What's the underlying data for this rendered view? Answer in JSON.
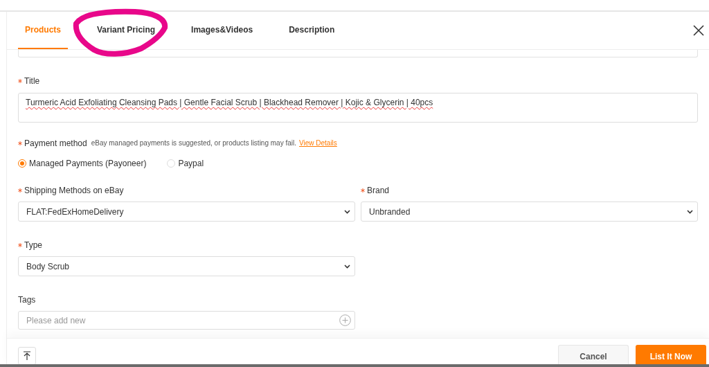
{
  "tabs": [
    {
      "label": "Products",
      "selected": true
    },
    {
      "label": "Variant Pricing",
      "selected": false
    },
    {
      "label": "Images&Videos",
      "selected": false
    },
    {
      "label": "Description",
      "selected": false
    }
  ],
  "title_field": {
    "label": "Title",
    "required": true,
    "value": "Turmeric Acid Exfoliating Cleansing Pads | Gentle Facial Scrub | Blackhead Remover | Kojic & Glycerin | 40pcs"
  },
  "payment": {
    "label": "Payment method",
    "required": true,
    "note": "eBay managed payments is suggested, or products listing may fail.",
    "link": "View Details",
    "options": [
      {
        "label": "Managed Payments (Payoneer)",
        "selected": true
      },
      {
        "label": "Paypal",
        "selected": false
      }
    ]
  },
  "selects": [
    {
      "label": "Shipping Methods on eBay",
      "required": true,
      "value": "FLAT:FedExHomeDelivery"
    },
    {
      "label": "Brand",
      "required": true,
      "value": "Unbranded"
    },
    {
      "label": "Type",
      "required": true,
      "value": "Body Scrub"
    }
  ],
  "tags": {
    "label": "Tags",
    "placeholder": "Please add new"
  },
  "buttons": {
    "cancel": "Cancel",
    "submit": "List It Now"
  }
}
